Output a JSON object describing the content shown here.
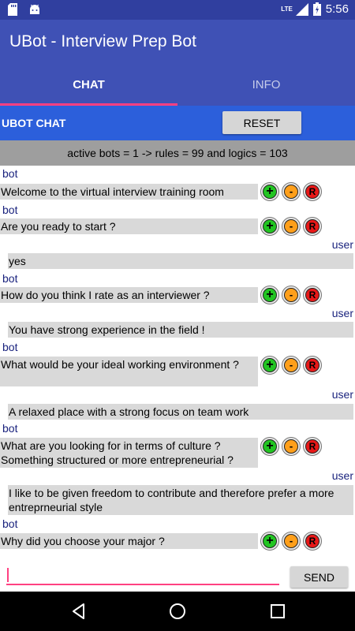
{
  "status_bar": {
    "network": "LTE",
    "time": "5:56",
    "icons": [
      "sd-card-icon",
      "android-icon",
      "signal-icon",
      "battery-icon"
    ]
  },
  "app_bar": {
    "title": "UBot - Interview Prep Bot"
  },
  "tabs": [
    {
      "label": "CHAT",
      "active": true
    },
    {
      "label": "INFO",
      "active": false
    }
  ],
  "chat_header": {
    "title": "UBOT CHAT",
    "reset_label": "RESET"
  },
  "info_bar": {
    "text": "active bots = 1 -> rules = 99 and logics = 103"
  },
  "messages": [
    {
      "sender": "bot",
      "text": "Welcome to the virtual interview training room"
    },
    {
      "sender": "bot",
      "text": "Are you ready to start ?"
    },
    {
      "sender": "user",
      "text": "yes"
    },
    {
      "sender": "bot",
      "text": "How do you think I rate as an interviewer ?"
    },
    {
      "sender": "user",
      "text": "You have strong experience in the field !"
    },
    {
      "sender": "bot",
      "text": "What would be your ideal working environment ?"
    },
    {
      "sender": "user",
      "text": "A relaxed place with a strong focus on team work"
    },
    {
      "sender": "bot",
      "text": "What are you looking for in terms of culture ? Something structured or more entrepreneurial ?"
    },
    {
      "sender": "user",
      "text": "I like to be given freedom to contribute and therefore prefer a more entreprneurial style"
    },
    {
      "sender": "bot",
      "text": "Why did you choose your major ?"
    }
  ],
  "rate_buttons": {
    "plus": "+",
    "minus": "-",
    "r": "R"
  },
  "input": {
    "value": "",
    "placeholder": "",
    "send_label": "SEND"
  },
  "colors": {
    "primary": "#3F51B5",
    "primary_dark": "#303F9F",
    "accent": "#FF4081",
    "chat_header": "#2C5FDB"
  }
}
